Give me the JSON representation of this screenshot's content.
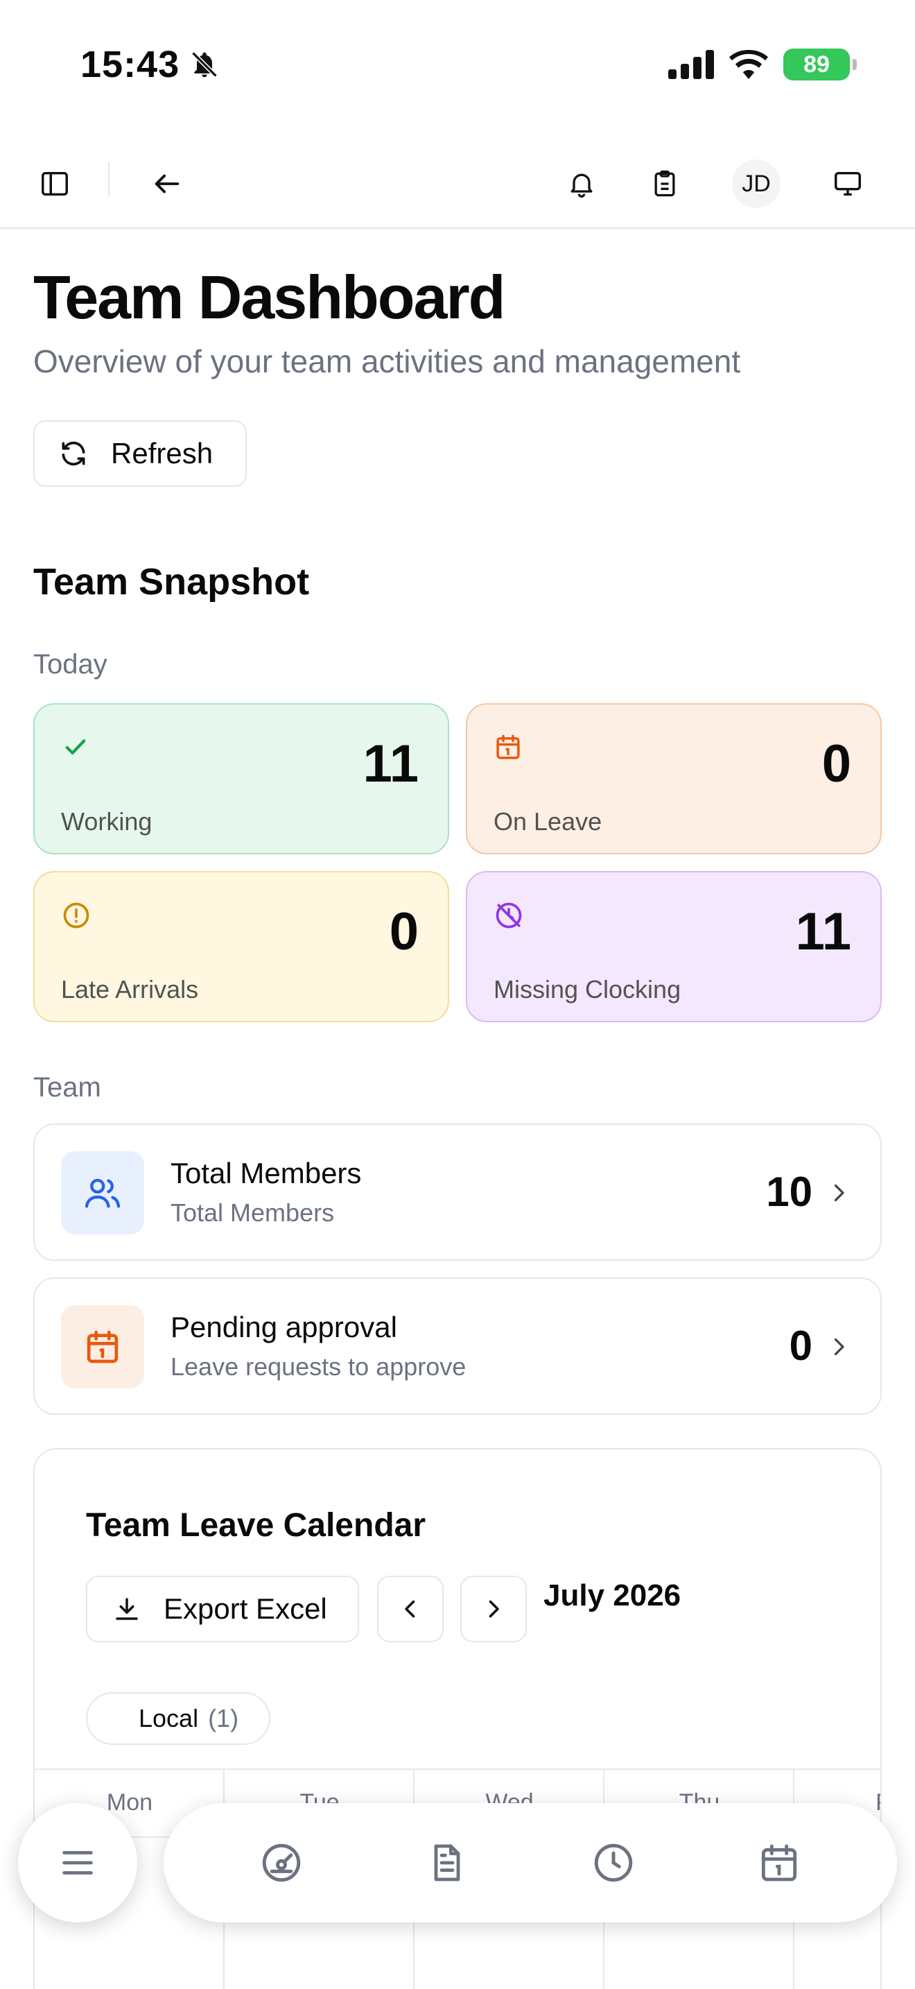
{
  "status_bar": {
    "time": "15:43",
    "battery": "89"
  },
  "nav": {
    "avatar_initials": "JD"
  },
  "header": {
    "title": "Team Dashboard",
    "subtitle": "Overview of your team activities and management",
    "refresh_label": "Refresh"
  },
  "snapshot": {
    "title": "Team Snapshot",
    "today_label": "Today",
    "cards": [
      {
        "label": "Working",
        "value": "11",
        "icon": "check-icon",
        "color": "#16a34a"
      },
      {
        "label": "On Leave",
        "value": "0",
        "icon": "calendar-icon",
        "color": "#ea580c"
      },
      {
        "label": "Late Arrivals",
        "value": "0",
        "icon": "alert-circle-icon",
        "color": "#ca8a04"
      },
      {
        "label": "Missing Clocking",
        "value": "11",
        "icon": "clock-off-icon",
        "color": "#9333ea"
      }
    ]
  },
  "team": {
    "label": "Team",
    "rows": [
      {
        "title": "Total Members",
        "subtitle": "Total Members",
        "value": "10",
        "icon": "users-icon"
      },
      {
        "title": "Pending approval",
        "subtitle": "Leave requests to approve",
        "value": "0",
        "icon": "calendar-icon"
      }
    ]
  },
  "calendar": {
    "title": "Team Leave Calendar",
    "export_label": "Export Excel",
    "month": "July 2026",
    "filter": {
      "label": "Local",
      "count": "(1)"
    },
    "days": [
      "Mon",
      "Tue",
      "Wed",
      "Thu",
      "Fri"
    ]
  },
  "bottom_nav": {
    "items": [
      "menu-icon",
      "dashboard-icon",
      "document-icon",
      "clock-icon",
      "calendar-icon"
    ]
  }
}
